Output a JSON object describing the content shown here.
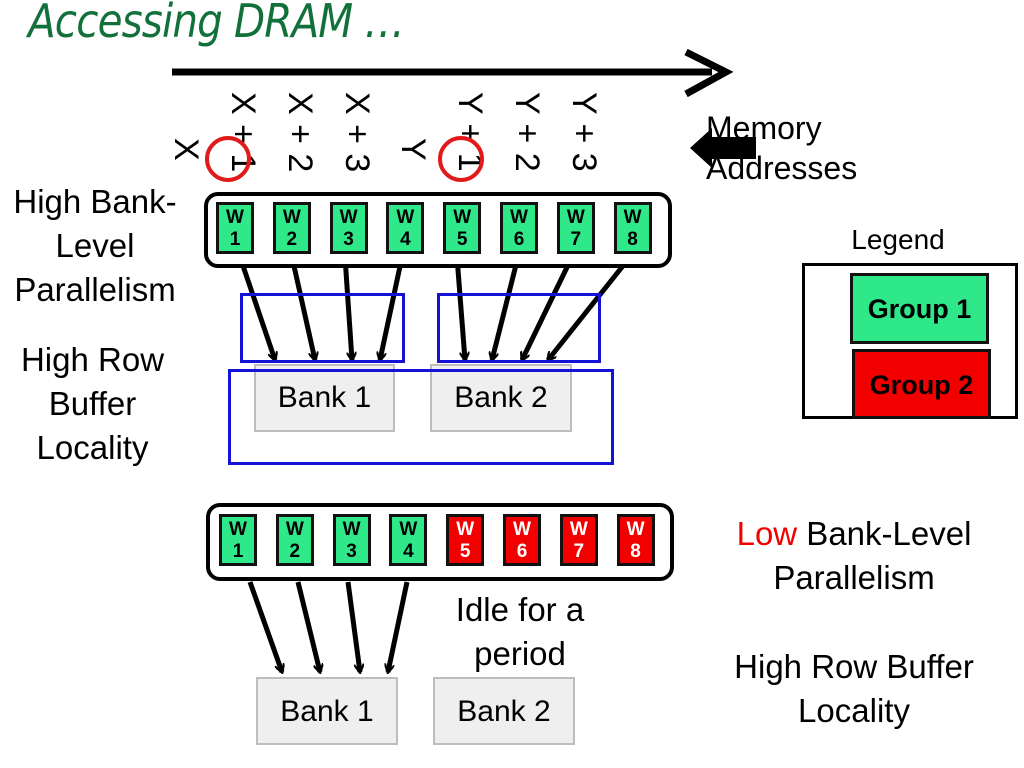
{
  "title": "Accessing DRAM …",
  "memory_addresses_label": [
    "Memory",
    "Addresses"
  ],
  "addresses": [
    "X",
    "X + 1",
    "X + 2",
    "X + 3",
    "Y",
    "Y + 1",
    "Y + 2",
    "Y + 3"
  ],
  "circled_addresses": [
    "X",
    "Y"
  ],
  "top_scenario": {
    "left_labels": {
      "blp": [
        "High Bank-",
        "Level",
        "Parallelism"
      ],
      "rbl": [
        "High Row",
        "Buffer",
        "Locality"
      ]
    },
    "requests": [
      {
        "w": "W",
        "n": "1",
        "group": "Group 1"
      },
      {
        "w": "W",
        "n": "2",
        "group": "Group 1"
      },
      {
        "w": "W",
        "n": "3",
        "group": "Group 1"
      },
      {
        "w": "W",
        "n": "4",
        "group": "Group 1"
      },
      {
        "w": "W",
        "n": "5",
        "group": "Group 1"
      },
      {
        "w": "W",
        "n": "6",
        "group": "Group 1"
      },
      {
        "w": "W",
        "n": "7",
        "group": "Group 1"
      },
      {
        "w": "W",
        "n": "8",
        "group": "Group 1"
      }
    ],
    "banks": [
      "Bank 1",
      "Bank 2"
    ],
    "mapping": {
      "Bank 1": [
        "W1",
        "W2",
        "W3",
        "W4"
      ],
      "Bank 2": [
        "W5",
        "W6",
        "W7",
        "W8"
      ]
    }
  },
  "bottom_scenario": {
    "requests": [
      {
        "w": "W",
        "n": "1",
        "group": "Group 1"
      },
      {
        "w": "W",
        "n": "2",
        "group": "Group 1"
      },
      {
        "w": "W",
        "n": "3",
        "group": "Group 1"
      },
      {
        "w": "W",
        "n": "4",
        "group": "Group 1"
      },
      {
        "w": "W",
        "n": "5",
        "group": "Group 2"
      },
      {
        "w": "W",
        "n": "6",
        "group": "Group 2"
      },
      {
        "w": "W",
        "n": "7",
        "group": "Group 2"
      },
      {
        "w": "W",
        "n": "8",
        "group": "Group 2"
      }
    ],
    "banks": [
      "Bank 1",
      "Bank 2"
    ],
    "mapping": {
      "Bank 1": [
        "W1",
        "W2",
        "W3",
        "W4"
      ]
    },
    "idle_note": [
      "Idle for a",
      "period"
    ],
    "right_labels": {
      "blp_low_word": "Low",
      "blp_rest": " Bank-Level",
      "blp_line2": "Parallelism",
      "rbl": [
        "High Row Buffer",
        "Locality"
      ]
    }
  },
  "legend": {
    "title": "Legend",
    "items": [
      {
        "label": "Group 1",
        "color": "#2ee889"
      },
      {
        "label": "Group 2",
        "color": "#f20000"
      }
    ]
  },
  "colors": {
    "title": "#12713b",
    "group1": "#2ee889",
    "group2": "#f20000",
    "highlight": "#1212d8",
    "circle": "#e11b1b"
  }
}
